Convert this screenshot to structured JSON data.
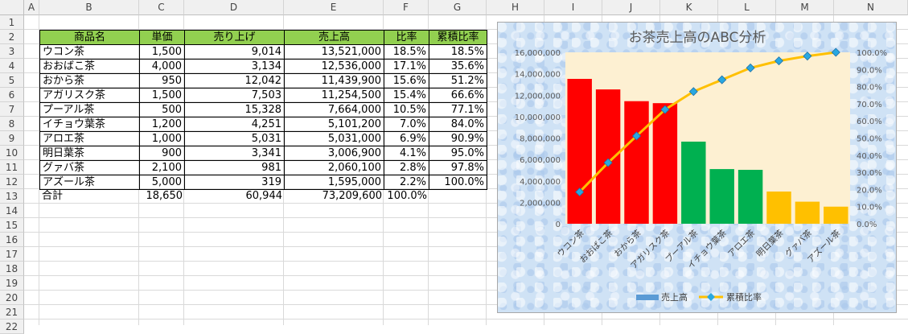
{
  "columns": [
    "A",
    "B",
    "C",
    "D",
    "E",
    "F",
    "G",
    "H",
    "I",
    "J",
    "K",
    "L",
    "M",
    "N"
  ],
  "rows": [
    "1",
    "2",
    "3",
    "4",
    "5",
    "6",
    "7",
    "8",
    "9",
    "10",
    "11",
    "12",
    "13",
    "14",
    "15",
    "16",
    "17",
    "18",
    "19",
    "20",
    "21",
    "22"
  ],
  "table": {
    "headers": [
      "商品名",
      "単価",
      "売り上げ",
      "売上高",
      "比率",
      "累積比率"
    ],
    "rows": [
      [
        "ウコン茶",
        "1,500",
        "9,014",
        "13,521,000",
        "18.5%",
        "18.5%"
      ],
      [
        "おおばこ茶",
        "4,000",
        "3,134",
        "12,536,000",
        "17.1%",
        "35.6%"
      ],
      [
        "おから茶",
        "950",
        "12,042",
        "11,439,900",
        "15.6%",
        "51.2%"
      ],
      [
        "アガリスク茶",
        "1,500",
        "7,503",
        "11,254,500",
        "15.4%",
        "66.6%"
      ],
      [
        "プーアル茶",
        "500",
        "15,328",
        "7,664,000",
        "10.5%",
        "77.1%"
      ],
      [
        "イチョウ葉茶",
        "1,200",
        "4,251",
        "5,101,200",
        "7.0%",
        "84.0%"
      ],
      [
        "アロエ茶",
        "1,000",
        "5,031",
        "5,031,000",
        "6.9%",
        "90.9%"
      ],
      [
        "明日葉茶",
        "900",
        "3,341",
        "3,006,900",
        "4.1%",
        "95.0%"
      ],
      [
        "グァバ茶",
        "2,100",
        "981",
        "2,060,100",
        "2.8%",
        "97.8%"
      ],
      [
        "アズール茶",
        "5,000",
        "319",
        "1,595,000",
        "2.2%",
        "100.0%"
      ]
    ],
    "total": [
      "合計",
      "18,650",
      "60,944",
      "73,209,600",
      "100.0%"
    ]
  },
  "colors": {
    "header_fill": "#92d050",
    "bar_a": "#ff0000",
    "bar_b": "#00b050",
    "bar_c": "#ffc000",
    "line": "#ffc000",
    "marker": "#29a8e0",
    "plot_bg": "#fdf0d2"
  },
  "chart_data": {
    "type": "bar+line",
    "title": "お茶売上高のABC分析",
    "categories": [
      "ウコン茶",
      "おおばこ茶",
      "おから茶",
      "アガリスク茶",
      "プーアル茶",
      "イチョウ葉茶",
      "アロエ茶",
      "明日葉茶",
      "グァバ茶",
      "アズール茶"
    ],
    "series": [
      {
        "name": "売上高",
        "type": "bar",
        "axis": "left",
        "values": [
          13521000,
          12536000,
          11439900,
          11254500,
          7664000,
          5101200,
          5031000,
          3006900,
          2060100,
          1595000
        ],
        "colors": [
          "#ff0000",
          "#ff0000",
          "#ff0000",
          "#ff0000",
          "#00b050",
          "#00b050",
          "#00b050",
          "#ffc000",
          "#ffc000",
          "#ffc000"
        ]
      },
      {
        "name": "累積比率",
        "type": "line",
        "axis": "right",
        "values": [
          18.5,
          35.6,
          51.2,
          66.6,
          77.1,
          84.0,
          90.9,
          95.0,
          97.8,
          100.0
        ]
      }
    ],
    "y_left": {
      "min": 0,
      "max": 16000000,
      "ticks": [
        "0",
        "2,000,000",
        "4,000,000",
        "6,000,000",
        "8,000,000",
        "10,000,000",
        "12,000,000",
        "14,000,000",
        "16,000,000"
      ]
    },
    "y_right": {
      "min": 0,
      "max": 100,
      "ticks": [
        "0.0%",
        "10.0%",
        "20.0%",
        "30.0%",
        "40.0%",
        "50.0%",
        "60.0%",
        "70.0%",
        "80.0%",
        "90.0%",
        "100.0%"
      ]
    },
    "legend": {
      "position": "bottom",
      "items": [
        "売上高",
        "累積比率"
      ]
    }
  }
}
